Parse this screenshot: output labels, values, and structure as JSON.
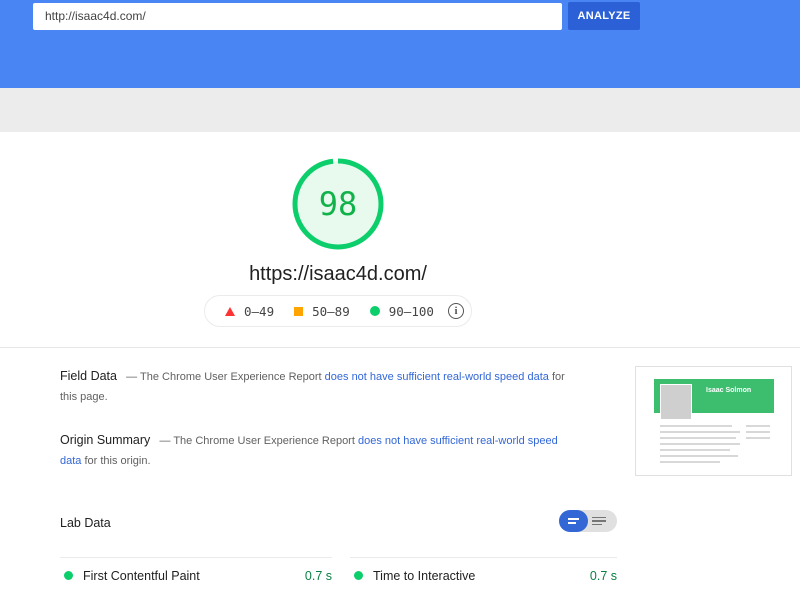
{
  "search": {
    "url_value": "http://isaac4d.com/",
    "analyze_label": "ANALYZE"
  },
  "score": {
    "value": "98",
    "fraction": 0.98,
    "color": "#0cce6b"
  },
  "page_url": "https://isaac4d.com/",
  "legend": {
    "poor": "0–49",
    "average": "50–89",
    "good": "90–100"
  },
  "field_data": {
    "title": "Field Data",
    "dash": "—",
    "prefix": "The Chrome User Experience Report",
    "link": "does not have sufficient real-world speed data",
    "suffix": "for this page."
  },
  "origin_summary": {
    "title": "Origin Summary",
    "dash": "—",
    "prefix": "The Chrome User Experience Report",
    "link": "does not have sufficient real-world speed data",
    "suffix": "for this origin."
  },
  "thumbnail": {
    "name": "Isaac Solmon"
  },
  "lab": {
    "title": "Lab Data",
    "metrics": [
      {
        "name": "First Contentful Paint",
        "value": "0.7 s",
        "status": "good"
      },
      {
        "name": "Time to Interactive",
        "value": "0.7 s",
        "status": "good"
      }
    ]
  },
  "colors": {
    "header": "#4a86f3",
    "accent": "#3367d6",
    "good": "#0cce6b",
    "average": "#ffa400",
    "poor": "#ff3333"
  }
}
